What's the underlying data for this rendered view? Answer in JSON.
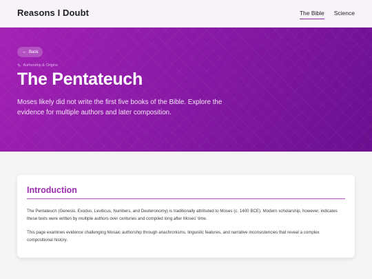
{
  "header": {
    "brand": "Reasons I Doubt",
    "nav": [
      {
        "label": "The Bible",
        "active": true
      },
      {
        "label": "Science",
        "active": false
      }
    ]
  },
  "hero": {
    "back_label": "Back",
    "back_icon": "arrow-left-icon",
    "category_icon": "pencil-icon",
    "category": "Authorship & Origins",
    "title": "The Pentateuch",
    "subtitle": "Moses likely did not write the first five books of the Bible. Explore the evidence for multiple authors and later composition."
  },
  "intro": {
    "heading": "Introduction",
    "paragraph1": "The Pentateuch (Genesis, Exodus, Leviticus, Numbers, and Deuteronomy) is traditionally attributed to Moses (c. 1400 BCE). Modern scholarship, however, indicates these texts were written by multiple authors over centuries and compiled long after Moses' time.",
    "paragraph2": "This page examines evidence challenging Mosaic authorship through anachronisms, linguistic features, and narrative inconsistencies that reveal a complex compositional history."
  },
  "colors": {
    "accent": "#9c2bb0",
    "hero_start": "#a322b4",
    "hero_end": "#6a0f8f"
  }
}
